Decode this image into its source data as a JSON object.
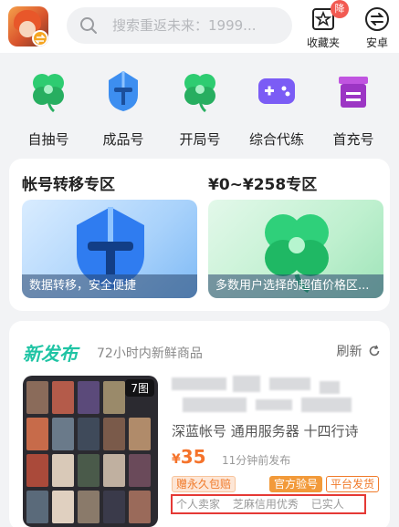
{
  "header": {
    "search_placeholder": "搜索重返未来：1999...",
    "favorites_label": "收藏夹",
    "favorites_badge": "降",
    "android_label": "安卓"
  },
  "categories": [
    {
      "label": "自抽号",
      "icon": "clover-icon"
    },
    {
      "label": "成品号",
      "icon": "helmet-icon"
    },
    {
      "label": "开局号",
      "icon": "clover-icon"
    },
    {
      "label": "综合代练",
      "icon": "gamepad-icon"
    },
    {
      "label": "首充号",
      "icon": "gift-box-icon"
    }
  ],
  "transfer": {
    "title_left": "帐号转移专区",
    "title_right": "¥0~¥258专区",
    "banner_left": "数据转移，安全便捷",
    "banner_right": "多数用户选择的超值价格区..."
  },
  "new_release": {
    "title": "新发布",
    "subtitle": "72小时内新鲜商品",
    "refresh_label": "刷新",
    "item": {
      "image_count": "7图",
      "title": "深蓝帐号 通用服务器 十四行诗",
      "price_symbol": "¥",
      "price": "35",
      "time": "11分钟前发布",
      "tags": [
        "赠永久包赔",
        "官方验号",
        "平台发货"
      ],
      "features": [
        "个人卖家",
        "芝麻信用优秀",
        "已实人"
      ]
    }
  },
  "colors": {
    "accent_green": "#1fc4a4",
    "price_orange": "#f5732b",
    "highlight_red": "#e53935"
  }
}
